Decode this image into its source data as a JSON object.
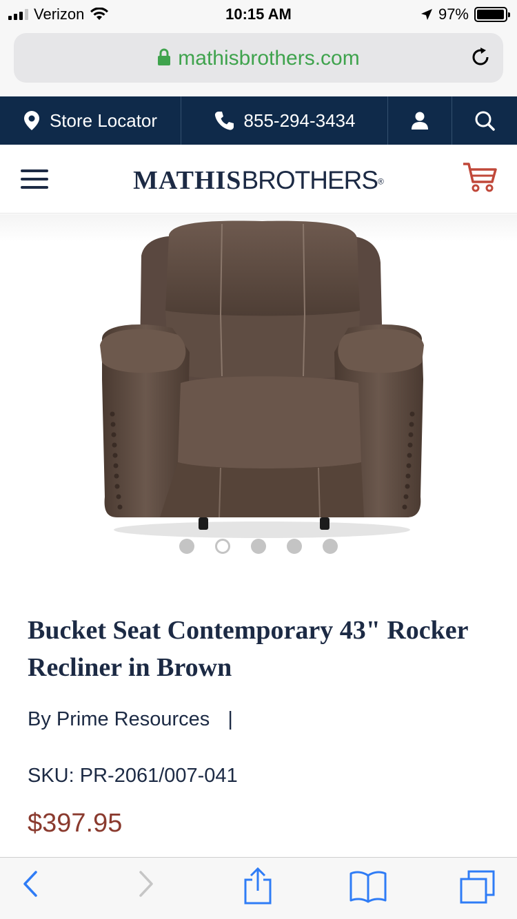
{
  "status_bar": {
    "carrier": "Verizon",
    "time": "10:15 AM",
    "battery_percent": "97%",
    "battery_level": 0.97
  },
  "browser": {
    "url": "mathisbrothers.com"
  },
  "top_nav": {
    "store_locator_label": "Store Locator",
    "phone": "855-294-3434"
  },
  "header": {
    "logo_bold": "MATHIS",
    "logo_light": "BROTHERS",
    "logo_mark": "®"
  },
  "carousel": {
    "total_slides": 5,
    "active_index": 1
  },
  "product": {
    "title": "Bucket Seat Contemporary 43\" Rocker Recliner in Brown",
    "by_line": "By Prime Resources",
    "separator": "|",
    "sku_label": "SKU:",
    "sku_value": "PR-2061/007-041",
    "price": "$397.95"
  },
  "colors": {
    "nav_bg": "#0f2a4a",
    "brand_text": "#1c2a44",
    "url_green": "#3fa34d",
    "price_color": "#8a3a2e",
    "cart_color": "#c0483a",
    "ios_blue": "#2f7cf6"
  },
  "icons": {
    "location": "location-pin-icon",
    "phone": "phone-icon",
    "account": "user-icon",
    "search": "search-icon",
    "menu": "hamburger-menu-icon",
    "cart": "shopping-cart-icon",
    "back": "chevron-left-icon",
    "forward": "chevron-right-icon",
    "share": "share-icon",
    "bookmarks": "book-icon",
    "tabs": "tabs-icon"
  }
}
